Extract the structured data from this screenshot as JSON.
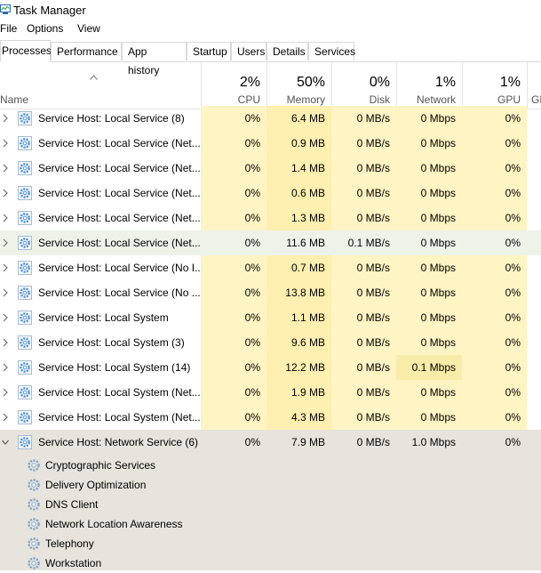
{
  "window": {
    "title": "Task Manager"
  },
  "menu": [
    "File",
    "Options",
    "View"
  ],
  "tabs": [
    "Processes",
    "Performance",
    "App history",
    "Startup",
    "Users",
    "Details",
    "Services"
  ],
  "active_tab": "Processes",
  "columns": {
    "name": "Name",
    "cpu": {
      "pct": "2%",
      "label": "CPU"
    },
    "memory": {
      "pct": "50%",
      "label": "Memory"
    },
    "disk": {
      "pct": "0%",
      "label": "Disk"
    },
    "network": {
      "pct": "1%",
      "label": "Network"
    },
    "gpu": {
      "pct": "1%",
      "label": "GPU"
    },
    "gpu_engine": {
      "label": "GP"
    }
  },
  "rows": [
    {
      "name": "Service Host: Local Service (8)",
      "cpu": "0%",
      "memory": "6.4 MB",
      "disk": "0 MB/s",
      "network": "0 Mbps",
      "gpu": "0%"
    },
    {
      "name": "Service Host: Local Service (Net...",
      "cpu": "0%",
      "memory": "0.9 MB",
      "disk": "0 MB/s",
      "network": "0 Mbps",
      "gpu": "0%"
    },
    {
      "name": "Service Host: Local Service (Net...",
      "cpu": "0%",
      "memory": "1.4 MB",
      "disk": "0 MB/s",
      "network": "0 Mbps",
      "gpu": "0%"
    },
    {
      "name": "Service Host: Local Service (Net...",
      "cpu": "0%",
      "memory": "0.6 MB",
      "disk": "0 MB/s",
      "network": "0 Mbps",
      "gpu": "0%"
    },
    {
      "name": "Service Host: Local Service (Net...",
      "cpu": "0%",
      "memory": "1.3 MB",
      "disk": "0 MB/s",
      "network": "0 Mbps",
      "gpu": "0%"
    },
    {
      "name": "Service Host: Local Service (Net...",
      "cpu": "0%",
      "memory": "11.6 MB",
      "disk": "0.1 MB/s",
      "network": "0 Mbps",
      "gpu": "0%"
    },
    {
      "name": "Service Host: Local Service (No I...",
      "cpu": "0%",
      "memory": "0.7 MB",
      "disk": "0 MB/s",
      "network": "0 Mbps",
      "gpu": "0%"
    },
    {
      "name": "Service Host: Local Service (No ...",
      "cpu": "0%",
      "memory": "13.8 MB",
      "disk": "0 MB/s",
      "network": "0 Mbps",
      "gpu": "0%"
    },
    {
      "name": "Service Host: Local System",
      "cpu": "0%",
      "memory": "1.1 MB",
      "disk": "0 MB/s",
      "network": "0 Mbps",
      "gpu": "0%"
    },
    {
      "name": "Service Host: Local System (3)",
      "cpu": "0%",
      "memory": "9.6 MB",
      "disk": "0 MB/s",
      "network": "0 Mbps",
      "gpu": "0%"
    },
    {
      "name": "Service Host: Local System (14)",
      "cpu": "0%",
      "memory": "12.2 MB",
      "disk": "0 MB/s",
      "network": "0.1 Mbps",
      "gpu": "0%"
    },
    {
      "name": "Service Host: Local System (Net...",
      "cpu": "0%",
      "memory": "1.9 MB",
      "disk": "0 MB/s",
      "network": "0 Mbps",
      "gpu": "0%"
    },
    {
      "name": "Service Host: Local System (Net...",
      "cpu": "0%",
      "memory": "4.3 MB",
      "disk": "0 MB/s",
      "network": "0 Mbps",
      "gpu": "0%"
    },
    {
      "name": "Service Host: Network Service (6)",
      "cpu": "0%",
      "memory": "7.9 MB",
      "disk": "0 MB/s",
      "network": "1.0 Mbps",
      "gpu": "0%"
    }
  ],
  "hovered_row": 5,
  "expanded_row": 13,
  "children": [
    "Cryptographic Services",
    "Delivery Optimization",
    "DNS Client",
    "Network Location Awareness",
    "Telephony",
    "Workstation"
  ],
  "colors": {
    "heat_light": "#fff4c4",
    "heat_medium": "#ffefb0",
    "heat_strong": "#f9eca8",
    "hover_row": "#eef3ea",
    "expanded_bg": "#e6e4dc",
    "gear": "#4a8fd6"
  }
}
